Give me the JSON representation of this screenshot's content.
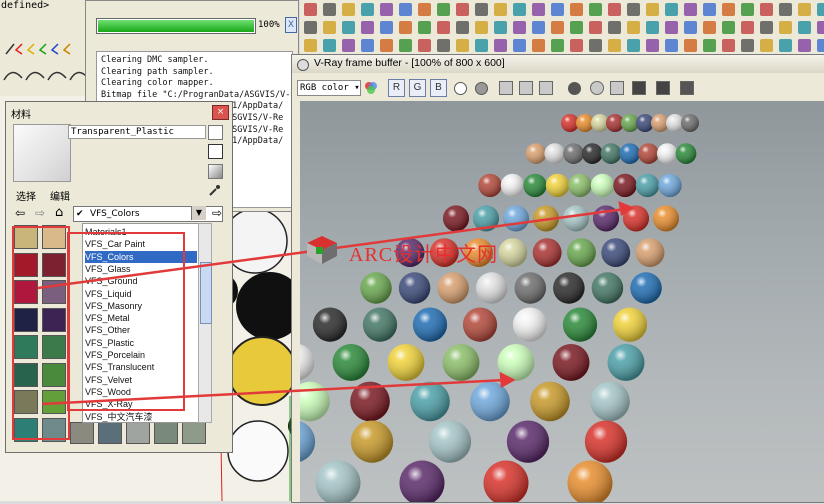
{
  "left_toolbar": {
    "undefined_label": "defined>"
  },
  "progress": {
    "percent_label": "100%",
    "close_label": "X",
    "log_lines": [
      "Clearing DMC sampler.",
      "Clearing path sampler.",
      "Clearing color mapper.",
      "Bitmap file \"C:/ProgranData/ASGVIS/V-Ra",
      "\"1/AppData/",
      "ASGVIS/V-Re",
      "ASGVIS/V-Re",
      "\"1/AppData/"
    ]
  },
  "vray": {
    "title": "V-Ray frame buffer - [100% of 800 x 600]",
    "channel_select": "RGB color",
    "channel_buttons": [
      "R",
      "G",
      "B"
    ]
  },
  "materials": {
    "panel_title": "材料",
    "close_label": "×",
    "material_name": "Transparent_Plastic",
    "tabs": [
      "选择",
      "编辑"
    ],
    "library_select": "VFS_Colors",
    "list": [
      "Materials1",
      "VFS_Car Paint",
      "VFS_Colors",
      "VFS_Glass",
      "VFS_Ground",
      "VFS_Liquid",
      "VFS_Masonry",
      "VFS_Metal",
      "VFS_Other",
      "VFS_Plastic",
      "VFS_Porcelain",
      "VFS_Translucent",
      "VFS_Velvet",
      "VFS_Wood",
      "VFS_X-Ray",
      "VFS_中文汽车漆"
    ],
    "selected_index": 2,
    "swatch_colors": [
      "#c9b47a",
      "#d9b98a",
      "#a4192a",
      "#7b2130",
      "#b0173d",
      "#7a5f7e",
      "#1f2245",
      "#3c2353",
      "#2f7a5a",
      "#3d7a4a",
      "#27634d",
      "#4a8a3d",
      "#7a7a5a",
      "#63a03a",
      "#2c7f75",
      "#6e8a8a"
    ],
    "bottom_swatch_colors": [
      "#8a8a80",
      "#5a6f7a",
      "#9fa4a0",
      "#7a8a7a",
      "#8e9a8a"
    ]
  },
  "watermark": {
    "text": "ARC设计中文网"
  },
  "colors": {
    "annotation_red": "#e23a3a",
    "selection_blue": "#316ac5",
    "progress_green": "#28b828"
  }
}
